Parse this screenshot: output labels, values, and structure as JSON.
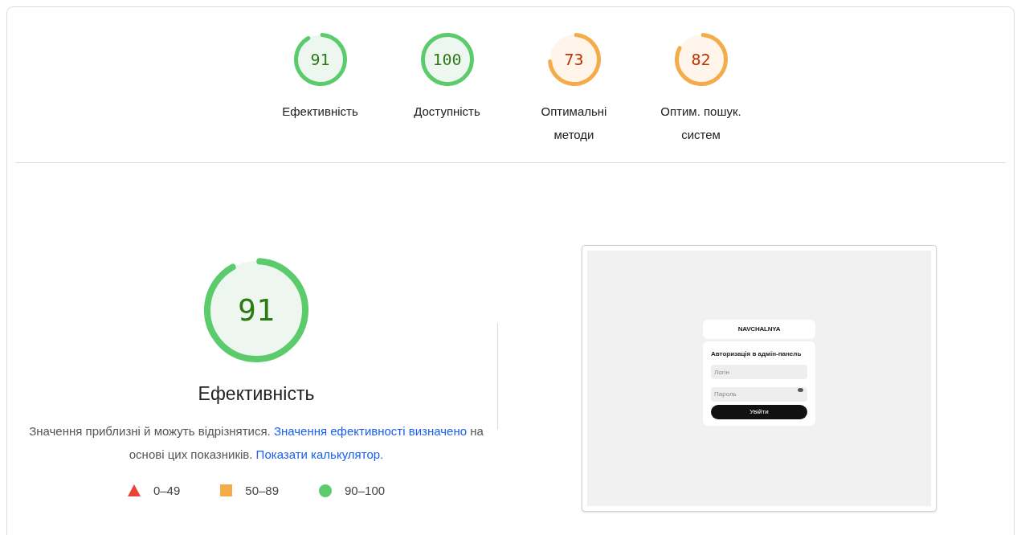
{
  "scores": [
    {
      "score": "91",
      "label": "Ефективність"
    },
    {
      "score": "100",
      "label": "Доступність"
    },
    {
      "score": "73",
      "label": "Оптимальні методи"
    },
    {
      "score": "82",
      "label": "Оптим. пошук. систем"
    }
  ],
  "main_gauge": {
    "score": "91",
    "title": "Ефективність"
  },
  "description": [
    {
      "text": "Значення приблизні й можуть відрізнятися. ",
      "link": false
    },
    {
      "text": "Значення ефективності визначено",
      "link": true
    },
    {
      "text": " на основі цих показників. ",
      "link": false
    },
    {
      "text": "Показати калькулятор.",
      "link": true
    }
  ],
  "legend": [
    {
      "kind": "triangle",
      "range": "0–49",
      "color": "#eb4335"
    },
    {
      "kind": "square",
      "range": "50–89",
      "color": "#f4ac4a"
    },
    {
      "kind": "circle",
      "range": "90–100",
      "color": "#5ccb6c"
    }
  ],
  "screenshot": {
    "logo": "NAVCHALNYA",
    "heading": "Авторизація в адмін-панель",
    "login_placeholder": "Логін",
    "password_placeholder": "Пароль",
    "submit": "Увійти"
  }
}
